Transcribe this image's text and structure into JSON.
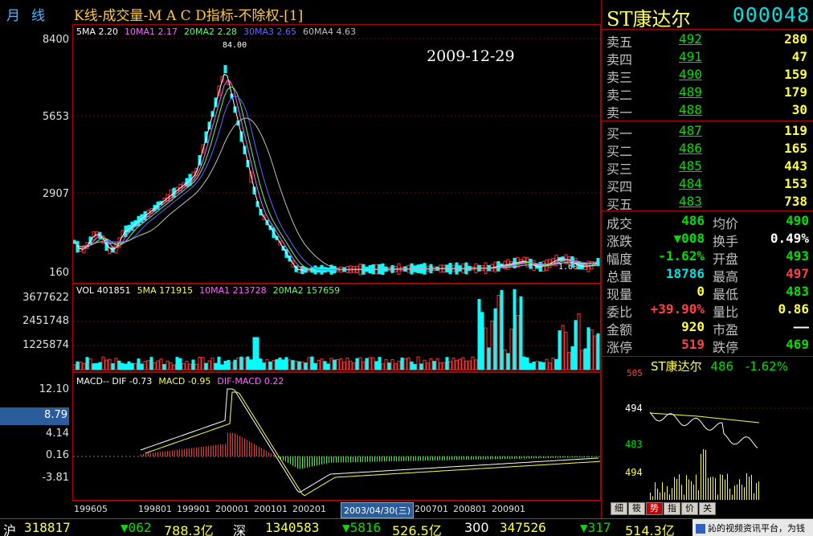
{
  "header": {
    "period": "月线",
    "title": "K线-成交量-M A C D指标-不除权-[1]",
    "date_overlay": "2009-12-29"
  },
  "main_chart": {
    "legend": [
      {
        "label": "5MA 2.20",
        "color": "#ffffff"
      },
      {
        "label": "10MA1 2.17",
        "color": "#ff66ff"
      },
      {
        "label": "20MA2 2.28",
        "color": "#66ff66"
      },
      {
        "label": "30MA3 2.65",
        "color": "#6666ff"
      },
      {
        "label": "60MA4 4.63",
        "color": "#c0c0c0"
      }
    ],
    "peak_label": "84.00",
    "y_ticks": [
      "8400",
      "5653",
      "2907",
      "160"
    ],
    "low_label": "1.60"
  },
  "volume_chart": {
    "legend": [
      {
        "label": "VOL 401851",
        "color": "#ffffff"
      },
      {
        "label": "5MA 171915",
        "color": "#ffff40"
      },
      {
        "label": "10MA1 213728",
        "color": "#ff66ff"
      },
      {
        "label": "20MA2 157659",
        "color": "#66ff66"
      }
    ],
    "y_ticks": [
      "3677622",
      "2451748",
      "1225874"
    ]
  },
  "macd_chart": {
    "legend": [
      {
        "label": "MACD-- DIF -0.73",
        "color": "#ffffff"
      },
      {
        "label": "MACD -0.95",
        "color": "#ffff40"
      },
      {
        "label": "DIF-MACD 0.22",
        "color": "#ff66ff"
      }
    ],
    "y_ticks": [
      "12.10",
      "8.79",
      "4.14",
      "0.16",
      "-3.81"
    ]
  },
  "x_axis": {
    "labels": [
      "199605",
      "199801",
      "199901",
      "200001",
      "200101",
      "200201",
      "0501",
      "200601",
      "200701",
      "200801",
      "200901"
    ],
    "cursor_label": "2003/04/30(三)"
  },
  "quote": {
    "name": "ST康达尔",
    "code": "000048",
    "asks": [
      {
        "label": "卖五",
        "price": "492",
        "vol": "280"
      },
      {
        "label": "卖四",
        "price": "491",
        "vol": "47"
      },
      {
        "label": "卖三",
        "price": "490",
        "vol": "159"
      },
      {
        "label": "卖二",
        "price": "489",
        "vol": "179"
      },
      {
        "label": "卖一",
        "price": "488",
        "vol": "30"
      }
    ],
    "bids": [
      {
        "label": "买一",
        "price": "487",
        "vol": "119"
      },
      {
        "label": "买二",
        "price": "486",
        "vol": "165"
      },
      {
        "label": "买三",
        "price": "485",
        "vol": "443"
      },
      {
        "label": "买四",
        "price": "484",
        "vol": "153"
      },
      {
        "label": "买五",
        "price": "483",
        "vol": "738"
      }
    ],
    "stats": [
      {
        "l1": "成交",
        "v1": "486",
        "c1": "#00e000",
        "l2": "均价",
        "v2": "490",
        "c2": "#00e000"
      },
      {
        "l1": "涨跌",
        "v1": "▼008",
        "c1": "#00e000",
        "l2": "换手",
        "v2": "0.49%",
        "c2": "#ffffff"
      },
      {
        "l1": "幅度",
        "v1": "-1.62%",
        "c1": "#00e000",
        "l2": "开盘",
        "v2": "493",
        "c2": "#00e000"
      },
      {
        "l1": "总量",
        "v1": "18786",
        "c1": "#00e0e0",
        "l2": "最高",
        "v2": "497",
        "c2": "#ff4040"
      },
      {
        "l1": "现量",
        "v1": "0",
        "c1": "#ffff40",
        "l2": "最低",
        "v2": "483",
        "c2": "#00e000"
      },
      {
        "l1": "委比",
        "v1": "+39.90%",
        "c1": "#ff4040",
        "l2": "量比",
        "v2": "0.86",
        "c2": "#ffff40"
      },
      {
        "l1": "金额",
        "v1": "920",
        "c1": "#ffff40",
        "l2": "市盈",
        "v2": "——",
        "c2": "#ffffff"
      },
      {
        "l1": "涨停",
        "v1": "519",
        "c1": "#ff4040",
        "l2": "跌停",
        "v2": "469",
        "c2": "#00e000"
      }
    ]
  },
  "mini_chart": {
    "name": "ST康达尔",
    "price": "486",
    "change": "-1.62%",
    "y_ticks": [
      "505",
      "494",
      "483",
      "494"
    ]
  },
  "tabs": [
    "细",
    "筱",
    "势",
    "指",
    "价",
    "关"
  ],
  "status_bar": {
    "sh_label": "沪",
    "sh_index": "318817",
    "sh_change": "▼062",
    "sh_amount": "788.3亿",
    "sz_label": "深",
    "sz_index": "1340583",
    "sz_change": "▼5816",
    "sz_amount": "526.5亿",
    "i300_label": "300",
    "i300_index": "347526",
    "i300_change": "▼317",
    "i300_amount": "514.3亿",
    "tray_text": "訫的视频资讯平台，为钱"
  }
}
